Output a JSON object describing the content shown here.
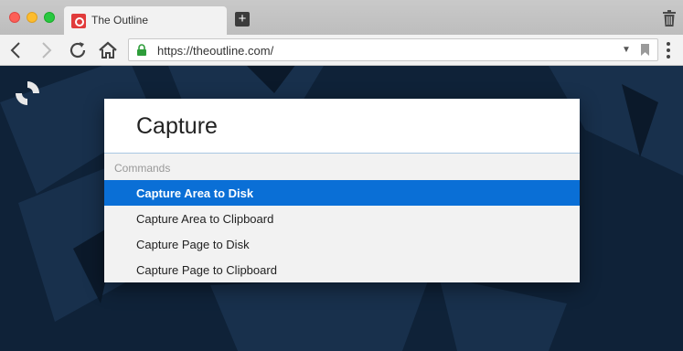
{
  "window": {
    "tab_title": "The Outline",
    "new_tab_symbol": "+"
  },
  "toolbar": {
    "url": "https://theoutline.com/",
    "dropdown_symbol": "▼"
  },
  "palette": {
    "query": "Capture",
    "section_label": "Commands",
    "commands": [
      {
        "label": "Capture Area to Disk",
        "selected": true
      },
      {
        "label": "Capture Area to Clipboard",
        "selected": false
      },
      {
        "label": "Capture Page to Disk",
        "selected": false
      },
      {
        "label": "Capture Page to Clipboard",
        "selected": false
      }
    ]
  },
  "icons": {
    "back": "chevron-left-icon",
    "forward": "chevron-right-icon",
    "reload": "reload-icon",
    "home": "home-icon",
    "lock": "lock-icon",
    "bookmark": "bookmark-icon",
    "menu": "kebab-menu-icon",
    "trash": "trash-icon"
  },
  "colors": {
    "selection": "#0a6fd6",
    "page_background": "#0f2238",
    "lock": "#2e9d3a"
  }
}
